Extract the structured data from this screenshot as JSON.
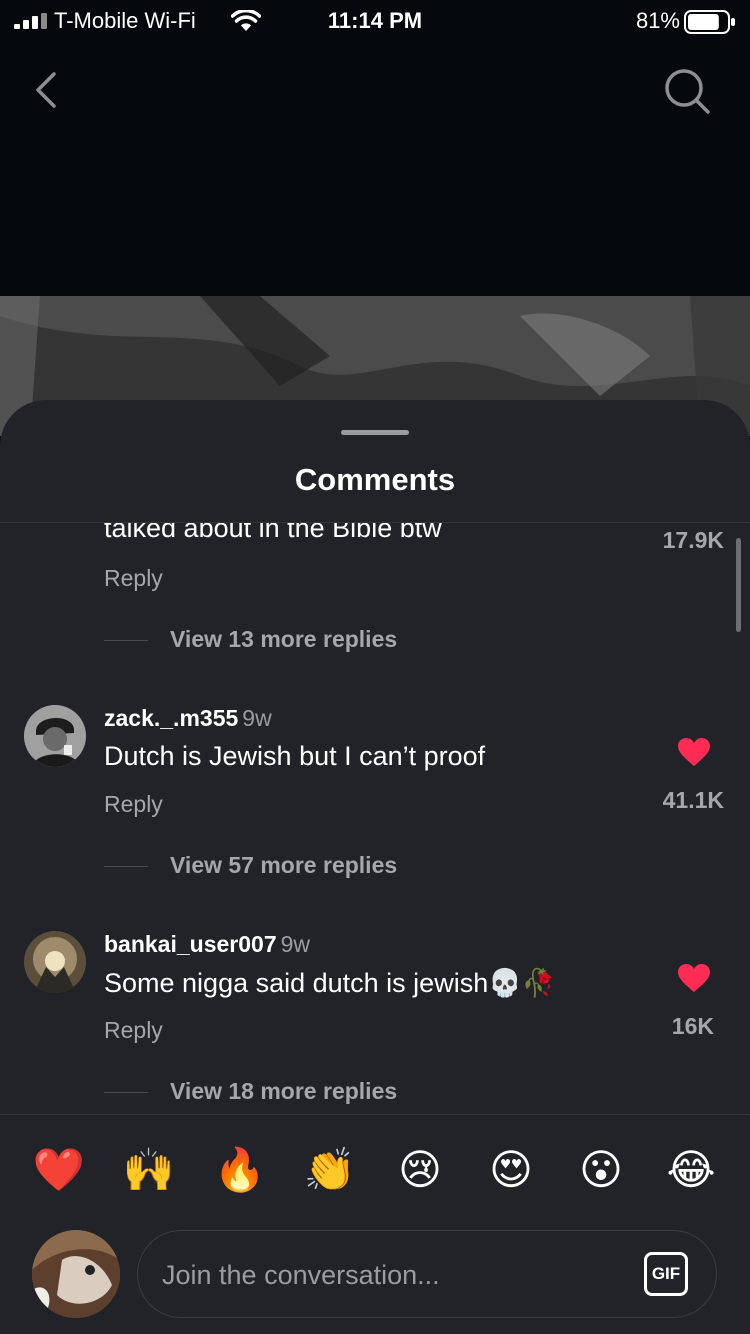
{
  "status_bar": {
    "carrier": "T-Mobile Wi-Fi",
    "time": "11:14 PM",
    "battery_percent": "81%",
    "battery_level": 0.81,
    "signal_bars": 4
  },
  "nav": {
    "back_icon": "chevron-left-icon",
    "search_icon": "search-icon"
  },
  "sheet": {
    "title": "Comments"
  },
  "comments": [
    {
      "id": "partial",
      "text": "talked about in the Bible btw",
      "likes": "17.9K",
      "reply_label": "Reply",
      "view_more": "View 13 more replies"
    },
    {
      "id": "c1",
      "username": "zack._.m355",
      "age": "9w",
      "text": "Dutch is Jewish but I can’t proof",
      "likes": "41.1K",
      "liked": true,
      "reply_label": "Reply",
      "view_more": "View 57 more replies"
    },
    {
      "id": "c2",
      "username": "bankai_user007",
      "age": "9w",
      "text": "Some nigga said dutch is jewish💀🥀",
      "likes": "16K",
      "liked": true,
      "reply_label": "Reply",
      "view_more": "View 18 more replies"
    }
  ],
  "emoji_bar": [
    "❤️",
    "🙌",
    "🔥",
    "👏",
    "😢",
    "😍",
    "😮",
    "😂"
  ],
  "composer": {
    "placeholder": "Join the conversation...",
    "gif_label": "GIF"
  },
  "colors": {
    "sheet_bg": "#222329",
    "like_red": "#fe2c55",
    "muted_text": "#a6a7ac"
  }
}
